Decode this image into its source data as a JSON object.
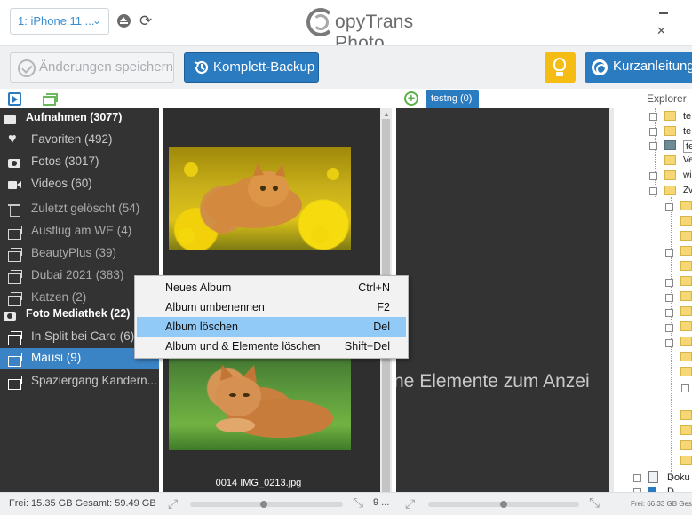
{
  "titlebar": {
    "device": "1: iPhone 11 ...",
    "app_title": "opyTrans Photo"
  },
  "toolbar": {
    "save_label": "Änderungen speichern",
    "backup_label": "Komplett-Backup",
    "guide_label": "Kurzanleitung"
  },
  "tabs": {
    "album_tab": "testng (0)",
    "explorer": "Explorer"
  },
  "sidebar": {
    "groups": [
      {
        "label": "Aufnahmen (3077)"
      },
      {
        "label": "Foto Mediathek (22)"
      }
    ],
    "items": [
      {
        "label": "Favoriten (492)",
        "icon": "heart-icon"
      },
      {
        "label": "Fotos (3017)",
        "icon": "camera-icon"
      },
      {
        "label": "Videos (60)",
        "icon": "video-icon"
      },
      {
        "label": "Zuletzt gelöscht (54)",
        "icon": "trash-icon"
      },
      {
        "label": "Ausflug am WE (4)",
        "icon": "album-icon"
      },
      {
        "label": "BeautyPlus (39)",
        "icon": "album-icon"
      },
      {
        "label": "Dubai 2021 (383)",
        "icon": "album-icon"
      },
      {
        "label": "Katzen  (2)",
        "icon": "album-icon"
      },
      {
        "label": "In Split bei Caro (6)",
        "icon": "album-icon"
      },
      {
        "label": "Mausi (9)",
        "icon": "album-icon"
      },
      {
        "label": "Spaziergang Kandern...",
        "icon": "album-icon"
      }
    ]
  },
  "photos": {
    "caption": "0014 IMG_0213.jpg"
  },
  "album_pane": {
    "empty_text": "ne Elemente zum Anzei"
  },
  "explorer": {
    "labels": [
      "te",
      "te",
      "te",
      "Ve",
      "wi",
      "Zv",
      "Doku",
      "D"
    ],
    "free": "Frei: 66.33 GB Ges"
  },
  "context_menu": {
    "items": [
      {
        "label": "Neues Album",
        "shortcut": "Ctrl+N"
      },
      {
        "label": "Album umbenennen",
        "shortcut": "F2"
      },
      {
        "label": "Album löschen",
        "shortcut": "Del"
      },
      {
        "label": "Album und & Elemente löschen",
        "shortcut": "Shift+Del"
      }
    ]
  },
  "status": {
    "text": "Frei: 15.35 GB Gesamt: 59.49 GB",
    "count": "9 ..."
  },
  "sliders": {
    "photo_zoom": 0.48,
    "album_zoom": 0.5
  },
  "colors": {
    "accent": "#2b7bc1",
    "selection": "#3a83c4",
    "tip": "#f5bd13",
    "menu_highlight": "#91c9f7"
  }
}
